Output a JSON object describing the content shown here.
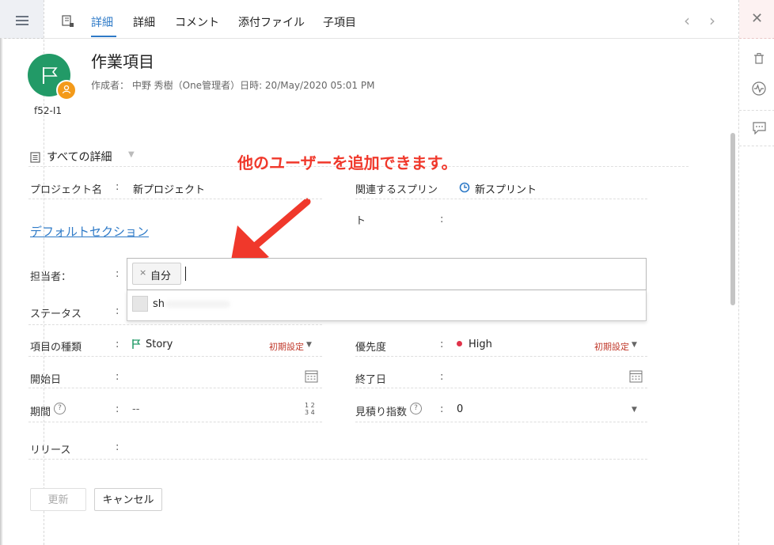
{
  "tabs": {
    "icon": "board-icon",
    "t1": "詳細",
    "t2": "詳細",
    "t3": "コメント",
    "t4": "添付ファイル",
    "t5": "子項目"
  },
  "nav": {
    "prev": "‹",
    "next": "›",
    "close": "✕"
  },
  "item": {
    "id": "f52-I1",
    "title": "作業項目",
    "meta": "作成者： 中野 秀樹（One管理者）日時: 20/May/2020 05:01 PM"
  },
  "section": {
    "heading": "すべての詳細",
    "default_link": "デフォルトセクション"
  },
  "callout": "他のユーザーを追加できます。",
  "fields": {
    "project_label": "プロジェクト名",
    "project_value": "新プロジェクト",
    "sprint_label": "関連するスプリン",
    "sprint_label2": "ト",
    "sprint_value": "新スプリント",
    "assignee_label": "担当者：",
    "status_label": "ステータス",
    "type_label": "項目の種類",
    "type_value": "Story",
    "default_setting": "初期設定",
    "priority_label": "優先度",
    "priority_value": "High",
    "priority_default": "初期設定",
    "start_label": "開始日",
    "end_label": "終了日",
    "duration_label": "期間",
    "duration_value": "--",
    "duration_icon_text": "1 2\n3 4",
    "estimate_label": "見積り指数",
    "estimate_value": "0",
    "release_label": "リリース",
    "colon": ":"
  },
  "assignee": {
    "chip_label": "自分",
    "chip_remove": "×",
    "suggestion": "sh"
  },
  "buttons": {
    "update": "更新",
    "cancel": "キャンセル"
  },
  "colors": {
    "accent": "#2e7ac7",
    "avatar": "#229a67",
    "badge": "#f39a1a",
    "callout": "#f0382b",
    "priority": "#e0334a"
  }
}
